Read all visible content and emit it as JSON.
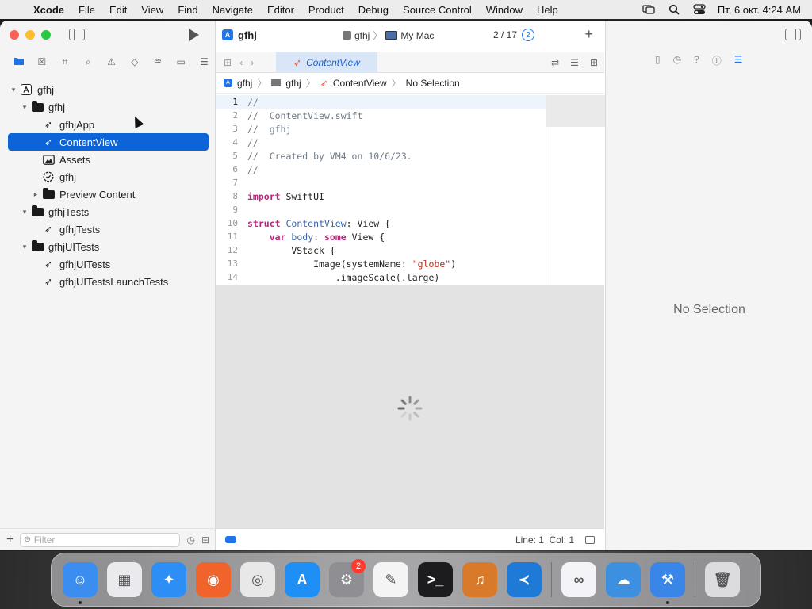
{
  "menubar": {
    "app_name": "Xcode",
    "items": [
      "File",
      "Edit",
      "View",
      "Find",
      "Navigate",
      "Editor",
      "Product",
      "Debug",
      "Source Control",
      "Window",
      "Help"
    ],
    "clock": "Пт, 6 окт.  4:24 AM"
  },
  "toolbar": {
    "project_title": "gfhj",
    "scheme_target": "gfhj",
    "destination": "My Mac",
    "counter": "2 / 17",
    "counter_badge": "2"
  },
  "navigator": {
    "filter_placeholder": "Filter",
    "items": [
      {
        "label": "gfhj",
        "level": 0,
        "icon": "project-icon",
        "disclosure": "open"
      },
      {
        "label": "gfhj",
        "level": 1,
        "icon": "folder-icon",
        "disclosure": "open"
      },
      {
        "label": "gfhjApp",
        "level": 2,
        "icon": "swift-file-icon",
        "disclosure": "none"
      },
      {
        "label": "ContentView",
        "level": 2,
        "icon": "swift-file-icon",
        "disclosure": "none",
        "selected": true
      },
      {
        "label": "Assets",
        "level": 2,
        "icon": "asset-catalog-icon",
        "disclosure": "none"
      },
      {
        "label": "gfhj",
        "level": 2,
        "icon": "entitlements-icon",
        "disclosure": "none"
      },
      {
        "label": "Preview Content",
        "level": 2,
        "icon": "folder-icon",
        "disclosure": "closed"
      },
      {
        "label": "gfhjTests",
        "level": 1,
        "icon": "folder-icon",
        "disclosure": "open"
      },
      {
        "label": "gfhjTests",
        "level": 2,
        "icon": "swift-file-icon",
        "disclosure": "none"
      },
      {
        "label": "gfhjUITests",
        "level": 1,
        "icon": "folder-icon",
        "disclosure": "open"
      },
      {
        "label": "gfhjUITests",
        "level": 2,
        "icon": "swift-file-icon",
        "disclosure": "none"
      },
      {
        "label": "gfhjUITestsLaunchTests",
        "level": 2,
        "icon": "swift-file-icon",
        "disclosure": "none"
      }
    ]
  },
  "editor": {
    "tab_label": "ContentView",
    "breadcrumb": [
      "gfhj",
      "gfhj",
      "ContentView",
      "No Selection"
    ],
    "code_lines": [
      {
        "n": "1",
        "parts": [
          {
            "t": "//",
            "c": "comment"
          }
        ]
      },
      {
        "n": "2",
        "parts": [
          {
            "t": "//  ContentView.swift",
            "c": "comment"
          }
        ]
      },
      {
        "n": "3",
        "parts": [
          {
            "t": "//  gfhj",
            "c": "comment"
          }
        ]
      },
      {
        "n": "4",
        "parts": [
          {
            "t": "//",
            "c": "comment"
          }
        ]
      },
      {
        "n": "5",
        "parts": [
          {
            "t": "//  Created by VM4 on 10/6/23.",
            "c": "comment"
          }
        ]
      },
      {
        "n": "6",
        "parts": [
          {
            "t": "//",
            "c": "comment"
          }
        ]
      },
      {
        "n": "7",
        "parts": []
      },
      {
        "n": "8",
        "parts": [
          {
            "t": "import",
            "c": "key"
          },
          {
            "t": " SwiftUI",
            "c": "plain"
          }
        ]
      },
      {
        "n": "9",
        "parts": []
      },
      {
        "n": "10",
        "parts": [
          {
            "t": "struct",
            "c": "key"
          },
          {
            "t": " ",
            "c": "plain"
          },
          {
            "t": "ContentView",
            "c": "type"
          },
          {
            "t": ": View {",
            "c": "plain"
          }
        ]
      },
      {
        "n": "11",
        "parts": [
          {
            "t": "    ",
            "c": "plain"
          },
          {
            "t": "var",
            "c": "key"
          },
          {
            "t": " ",
            "c": "plain"
          },
          {
            "t": "body",
            "c": "type"
          },
          {
            "t": ": ",
            "c": "plain"
          },
          {
            "t": "some",
            "c": "key"
          },
          {
            "t": " View {",
            "c": "plain"
          }
        ]
      },
      {
        "n": "12",
        "parts": [
          {
            "t": "        VStack {",
            "c": "plain"
          }
        ]
      },
      {
        "n": "13",
        "parts": [
          {
            "t": "            Image(systemName: ",
            "c": "plain"
          },
          {
            "t": "\"globe\"",
            "c": "str"
          },
          {
            "t": ")",
            "c": "plain"
          }
        ]
      },
      {
        "n": "14",
        "parts": [
          {
            "t": "                .imageScale(.large)",
            "c": "plain"
          }
        ]
      }
    ],
    "status_line": "Line: 1",
    "status_col": "Col: 1"
  },
  "inspector": {
    "empty_label": "No Selection"
  },
  "dock": {
    "apps": [
      {
        "name": "finder",
        "glyph": "☺",
        "color": "#3b8ef0",
        "running": true
      },
      {
        "name": "launchpad",
        "glyph": "▦",
        "color": "#e9e9ee",
        "running": false
      },
      {
        "name": "safari",
        "glyph": "✦",
        "color": "#2d8ff5",
        "running": false
      },
      {
        "name": "firefox",
        "glyph": "◉",
        "color": "#f0642b",
        "running": false
      },
      {
        "name": "chrome",
        "glyph": "◎",
        "color": "#e8e8e8",
        "running": false
      },
      {
        "name": "app-store",
        "glyph": "A",
        "color": "#1e8ff5",
        "running": false
      },
      {
        "name": "system-settings",
        "glyph": "⚙",
        "color": "#8e8e93",
        "running": false,
        "badge": "2"
      },
      {
        "name": "textedit",
        "glyph": "✎",
        "color": "#f4f4f4",
        "running": false
      },
      {
        "name": "terminal",
        "glyph": ">_",
        "color": "#1c1c1e",
        "running": false
      },
      {
        "name": "garageband",
        "glyph": "♫",
        "color": "#d97a2b",
        "running": false
      },
      {
        "name": "vscode",
        "glyph": "≺",
        "color": "#1e7ad6",
        "running": false
      },
      {
        "name": "visual-studio",
        "glyph": "∞",
        "color": "#f4f4f8",
        "running": false
      },
      {
        "name": "weather",
        "glyph": "☁",
        "color": "#3d8fe0",
        "running": false
      },
      {
        "name": "xcode",
        "glyph": "⚒",
        "color": "#3a86e8",
        "running": true
      },
      {
        "name": "trash",
        "glyph": "🗑",
        "color": "#dcdcdf",
        "running": false
      }
    ]
  }
}
